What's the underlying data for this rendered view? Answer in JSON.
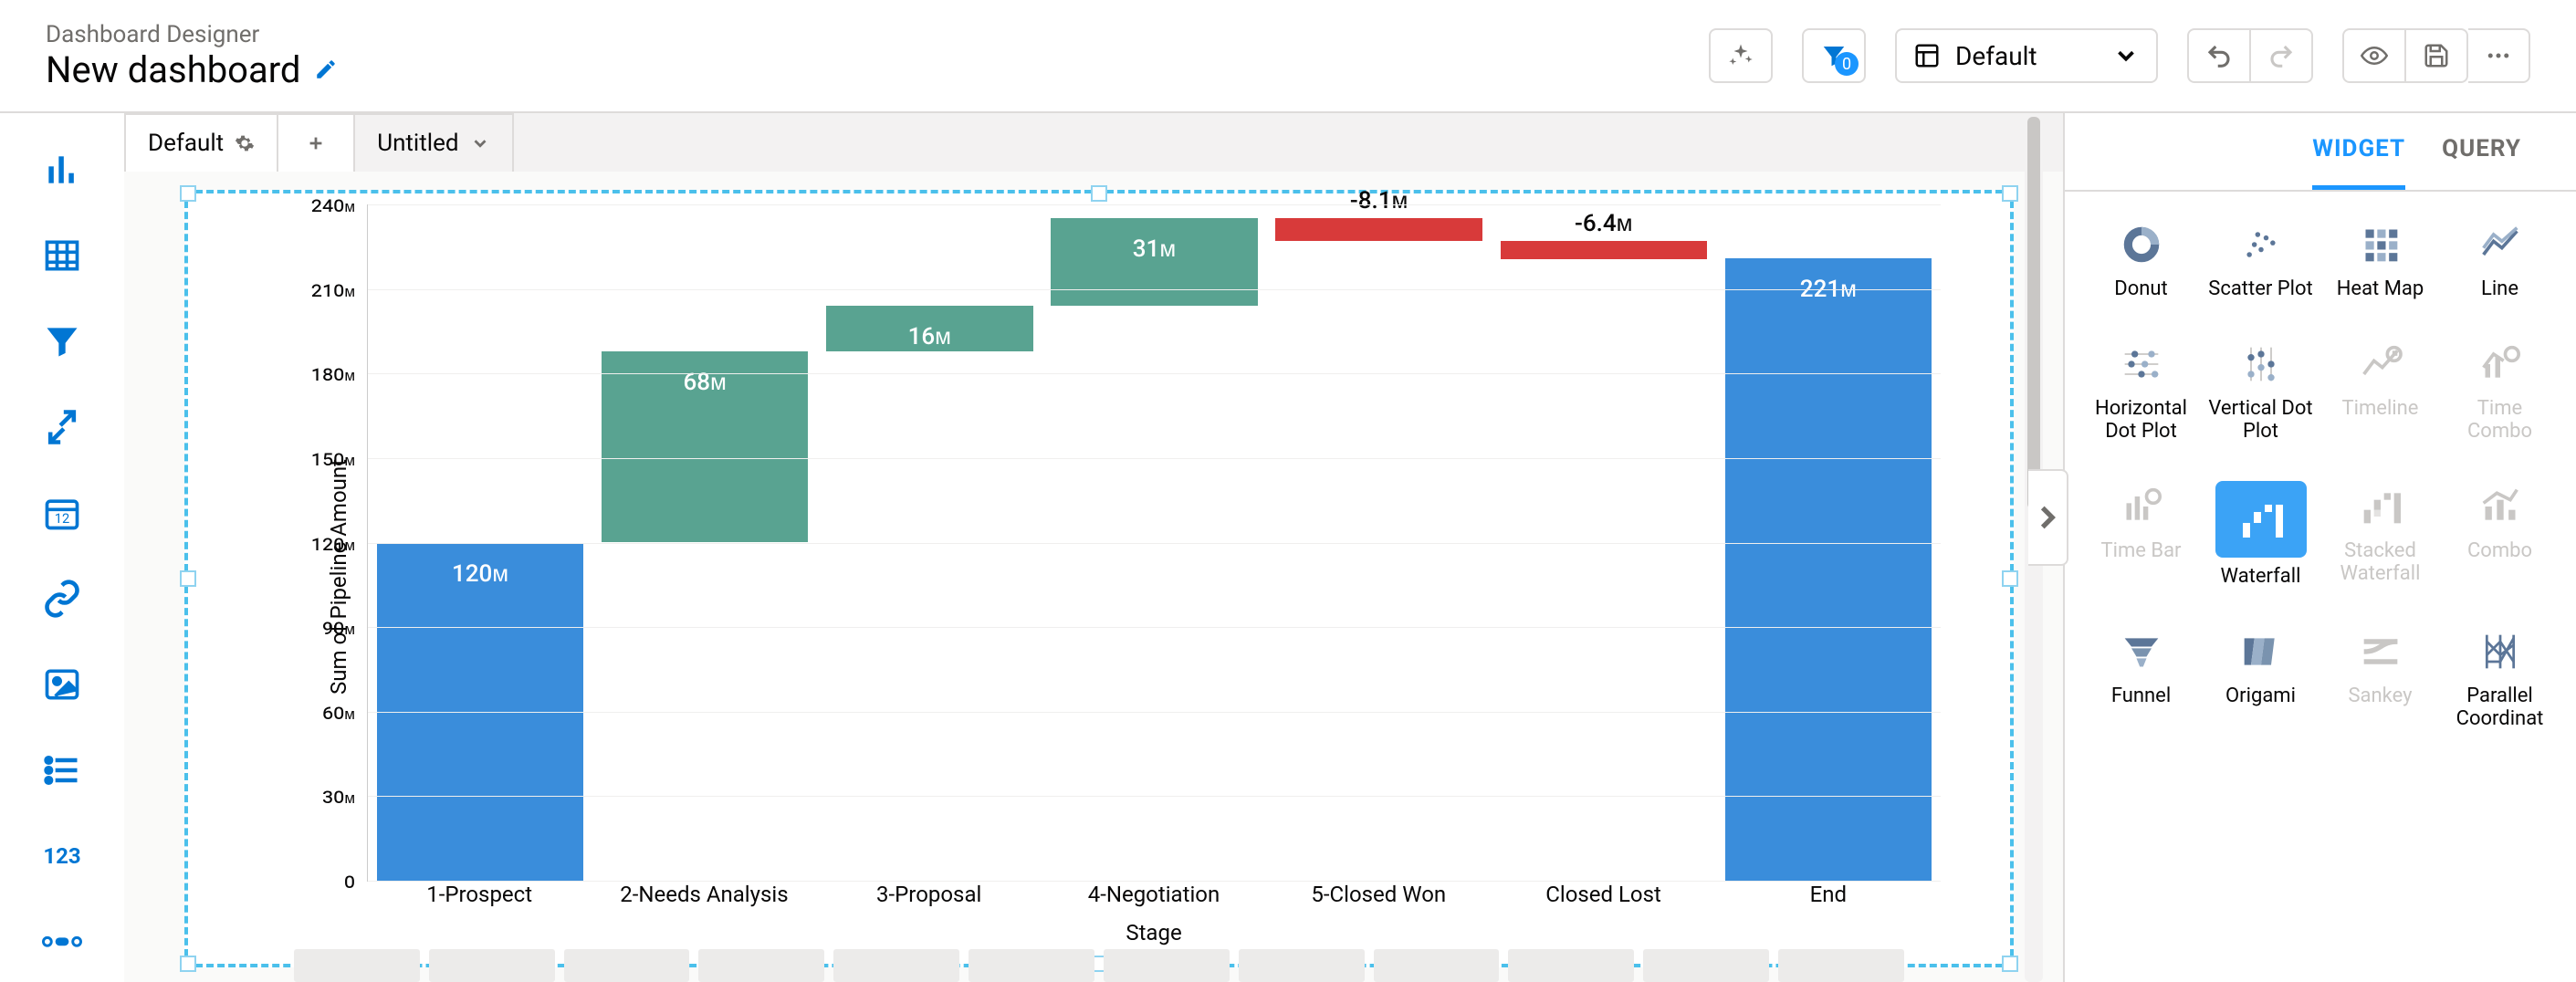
{
  "header": {
    "crumb": "Dashboard Designer",
    "title": "New dashboard",
    "layout_label": "Default",
    "filter_badge": "0"
  },
  "tabs": {
    "default": "Default",
    "untitled": "Untitled"
  },
  "right_panel": {
    "tab_widget": "WIDGET",
    "tab_query": "QUERY",
    "types": {
      "donut": "Donut",
      "scatter": "Scatter Plot",
      "heatmap": "Heat Map",
      "line": "Line",
      "hdot": "Horizontal Dot Plot",
      "vdot": "Vertical Dot Plot",
      "timeline": "Timeline",
      "timecombo": "Time Combo",
      "timebar": "Time Bar",
      "waterfall": "Waterfall",
      "stackedwf": "Stacked Waterfall",
      "combo": "Combo",
      "funnel": "Funnel",
      "origami": "Origami",
      "sankey": "Sankey",
      "parallel": "Parallel Coordinat"
    }
  },
  "rail": {
    "number_label": "123"
  },
  "chart_data": {
    "type": "bar",
    "subtype": "waterfall",
    "xlabel": "Stage",
    "ylabel": "Sum of Pipeline Amount",
    "ylim": [
      0,
      240
    ],
    "yticks": [
      0,
      30,
      60,
      90,
      120,
      150,
      180,
      210,
      240
    ],
    "ytick_labels": [
      "0",
      "30ᴍ",
      "60ᴍ",
      "90ᴍ",
      "120ᴍ",
      "150ᴍ",
      "180ᴍ",
      "210ᴍ",
      "240ᴍ"
    ],
    "categories": [
      "1-Prospect",
      "2-Needs Analysis",
      "3-Proposal",
      "4-Negotiation",
      "5-Closed Won",
      "Closed Lost",
      "End"
    ],
    "series": [
      {
        "category": "1-Prospect",
        "kind": "start",
        "value": 120,
        "label": "120ᴍ",
        "label_pos": "inside"
      },
      {
        "category": "2-Needs Analysis",
        "kind": "pos",
        "value": 68,
        "label": "68ᴍ",
        "label_pos": "inside"
      },
      {
        "category": "3-Proposal",
        "kind": "pos",
        "value": 16,
        "label": "16ᴍ",
        "label_pos": "inside"
      },
      {
        "category": "4-Negotiation",
        "kind": "pos",
        "value": 31,
        "label": "31ᴍ",
        "label_pos": "inside"
      },
      {
        "category": "5-Closed Won",
        "kind": "neg",
        "value": -8.1,
        "label": "-8.1ᴍ",
        "label_pos": "above"
      },
      {
        "category": "Closed Lost",
        "kind": "neg",
        "value": -6.4,
        "label": "-6.4ᴍ",
        "label_pos": "above"
      },
      {
        "category": "End",
        "kind": "end",
        "value": 221,
        "label": "221ᴍ",
        "label_pos": "inside"
      }
    ]
  }
}
